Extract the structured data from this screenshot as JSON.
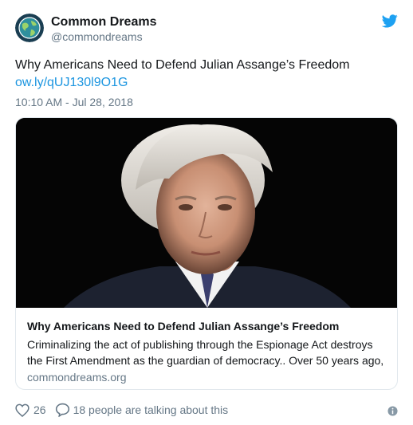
{
  "author": {
    "name": "Common Dreams",
    "handle": "@commondreams",
    "avatar_icon": "globe-logo-icon"
  },
  "tweet": {
    "text": "Why Americans Need to Defend Julian Assange’s Freedom",
    "link": "ow.ly/qUJ130l9O1G",
    "timestamp": "10:10 AM - Jul 28, 2018"
  },
  "card": {
    "image_icon": "article-photo",
    "title": "Why Americans Need to Defend Julian Assange’s Freedom",
    "description": "Criminalizing the act of publishing through the Espionage Act destroys the First Amendment as the guardian of democracy.. Over 50 years ago,",
    "domain": "commondreams.org"
  },
  "actions": {
    "likes": "26",
    "talking": "18 people are talking about this"
  },
  "colors": {
    "link": "#1b95e0",
    "secondary_text": "#657786",
    "brand_twitter": "#1da1f2",
    "avatar_bg": "#1a3e52"
  }
}
